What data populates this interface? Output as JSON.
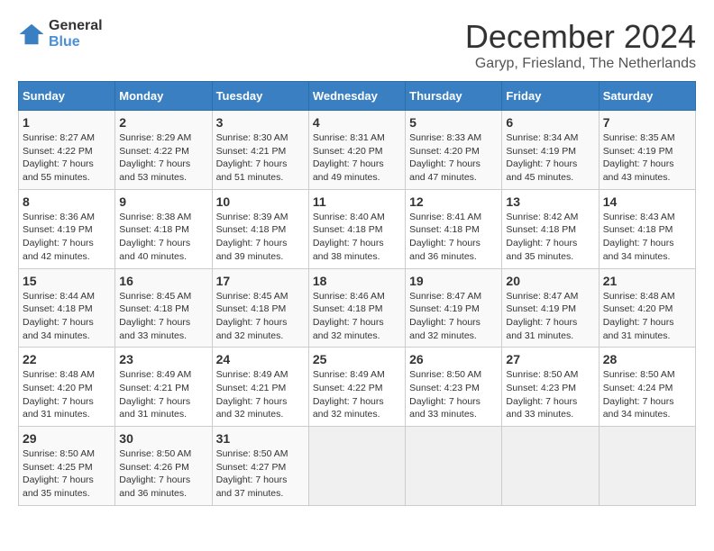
{
  "logo": {
    "general": "General",
    "blue": "Blue"
  },
  "title": "December 2024",
  "subtitle": "Garyp, Friesland, The Netherlands",
  "days_of_week": [
    "Sunday",
    "Monday",
    "Tuesday",
    "Wednesday",
    "Thursday",
    "Friday",
    "Saturday"
  ],
  "weeks": [
    [
      {
        "day": "1",
        "sunrise": "8:27 AM",
        "sunset": "4:22 PM",
        "daylight": "7 hours and 55 minutes."
      },
      {
        "day": "2",
        "sunrise": "8:29 AM",
        "sunset": "4:22 PM",
        "daylight": "7 hours and 53 minutes."
      },
      {
        "day": "3",
        "sunrise": "8:30 AM",
        "sunset": "4:21 PM",
        "daylight": "7 hours and 51 minutes."
      },
      {
        "day": "4",
        "sunrise": "8:31 AM",
        "sunset": "4:20 PM",
        "daylight": "7 hours and 49 minutes."
      },
      {
        "day": "5",
        "sunrise": "8:33 AM",
        "sunset": "4:20 PM",
        "daylight": "7 hours and 47 minutes."
      },
      {
        "day": "6",
        "sunrise": "8:34 AM",
        "sunset": "4:19 PM",
        "daylight": "7 hours and 45 minutes."
      },
      {
        "day": "7",
        "sunrise": "8:35 AM",
        "sunset": "4:19 PM",
        "daylight": "7 hours and 43 minutes."
      }
    ],
    [
      {
        "day": "8",
        "sunrise": "8:36 AM",
        "sunset": "4:19 PM",
        "daylight": "7 hours and 42 minutes."
      },
      {
        "day": "9",
        "sunrise": "8:38 AM",
        "sunset": "4:18 PM",
        "daylight": "7 hours and 40 minutes."
      },
      {
        "day": "10",
        "sunrise": "8:39 AM",
        "sunset": "4:18 PM",
        "daylight": "7 hours and 39 minutes."
      },
      {
        "day": "11",
        "sunrise": "8:40 AM",
        "sunset": "4:18 PM",
        "daylight": "7 hours and 38 minutes."
      },
      {
        "day": "12",
        "sunrise": "8:41 AM",
        "sunset": "4:18 PM",
        "daylight": "7 hours and 36 minutes."
      },
      {
        "day": "13",
        "sunrise": "8:42 AM",
        "sunset": "4:18 PM",
        "daylight": "7 hours and 35 minutes."
      },
      {
        "day": "14",
        "sunrise": "8:43 AM",
        "sunset": "4:18 PM",
        "daylight": "7 hours and 34 minutes."
      }
    ],
    [
      {
        "day": "15",
        "sunrise": "8:44 AM",
        "sunset": "4:18 PM",
        "daylight": "7 hours and 34 minutes."
      },
      {
        "day": "16",
        "sunrise": "8:45 AM",
        "sunset": "4:18 PM",
        "daylight": "7 hours and 33 minutes."
      },
      {
        "day": "17",
        "sunrise": "8:45 AM",
        "sunset": "4:18 PM",
        "daylight": "7 hours and 32 minutes."
      },
      {
        "day": "18",
        "sunrise": "8:46 AM",
        "sunset": "4:18 PM",
        "daylight": "7 hours and 32 minutes."
      },
      {
        "day": "19",
        "sunrise": "8:47 AM",
        "sunset": "4:19 PM",
        "daylight": "7 hours and 32 minutes."
      },
      {
        "day": "20",
        "sunrise": "8:47 AM",
        "sunset": "4:19 PM",
        "daylight": "7 hours and 31 minutes."
      },
      {
        "day": "21",
        "sunrise": "8:48 AM",
        "sunset": "4:20 PM",
        "daylight": "7 hours and 31 minutes."
      }
    ],
    [
      {
        "day": "22",
        "sunrise": "8:48 AM",
        "sunset": "4:20 PM",
        "daylight": "7 hours and 31 minutes."
      },
      {
        "day": "23",
        "sunrise": "8:49 AM",
        "sunset": "4:21 PM",
        "daylight": "7 hours and 31 minutes."
      },
      {
        "day": "24",
        "sunrise": "8:49 AM",
        "sunset": "4:21 PM",
        "daylight": "7 hours and 32 minutes."
      },
      {
        "day": "25",
        "sunrise": "8:49 AM",
        "sunset": "4:22 PM",
        "daylight": "7 hours and 32 minutes."
      },
      {
        "day": "26",
        "sunrise": "8:50 AM",
        "sunset": "4:23 PM",
        "daylight": "7 hours and 33 minutes."
      },
      {
        "day": "27",
        "sunrise": "8:50 AM",
        "sunset": "4:23 PM",
        "daylight": "7 hours and 33 minutes."
      },
      {
        "day": "28",
        "sunrise": "8:50 AM",
        "sunset": "4:24 PM",
        "daylight": "7 hours and 34 minutes."
      }
    ],
    [
      {
        "day": "29",
        "sunrise": "8:50 AM",
        "sunset": "4:25 PM",
        "daylight": "7 hours and 35 minutes."
      },
      {
        "day": "30",
        "sunrise": "8:50 AM",
        "sunset": "4:26 PM",
        "daylight": "7 hours and 36 minutes."
      },
      {
        "day": "31",
        "sunrise": "8:50 AM",
        "sunset": "4:27 PM",
        "daylight": "7 hours and 37 minutes."
      },
      null,
      null,
      null,
      null
    ]
  ],
  "labels": {
    "sunrise": "Sunrise:",
    "sunset": "Sunset:",
    "daylight": "Daylight:"
  }
}
